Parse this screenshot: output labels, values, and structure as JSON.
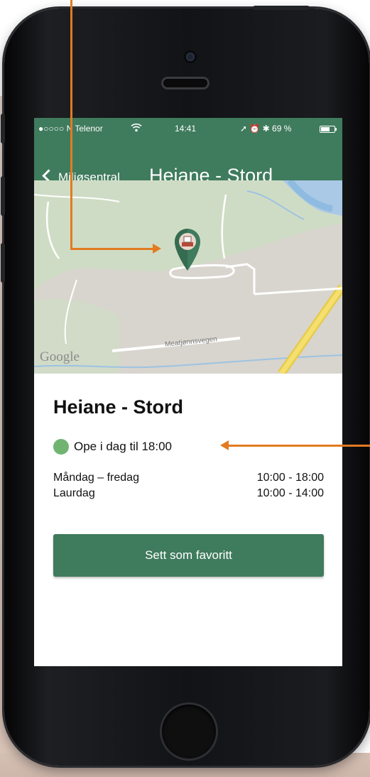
{
  "status_bar": {
    "carrier": "●○○○○ N Telenor",
    "wifi_icon": "wifi-icon",
    "time": "14:41",
    "indicators": "➚ ⏰ ✱ 69 %"
  },
  "nav_bar": {
    "back_label": "Miljøsentral",
    "title": "Heiane - Stord"
  },
  "map": {
    "attribution": "Google",
    "road_label": "Meatjønnsvegen",
    "marker_icon": "recycling-station-pin-icon"
  },
  "detail": {
    "title": "Heiane - Stord",
    "open_status": "Ope i dag til 18:00",
    "open_status_color": "#71b472",
    "hours": [
      {
        "day": "Måndag – fredag",
        "time": "10:00 - 18:00"
      },
      {
        "day": "Laurdag",
        "time": "10:00 - 14:00"
      }
    ],
    "favorite_button": "Sett som favoritt"
  },
  "theme": {
    "brand_green": "#3f7b5d",
    "annotation_orange": "#e27b22"
  }
}
